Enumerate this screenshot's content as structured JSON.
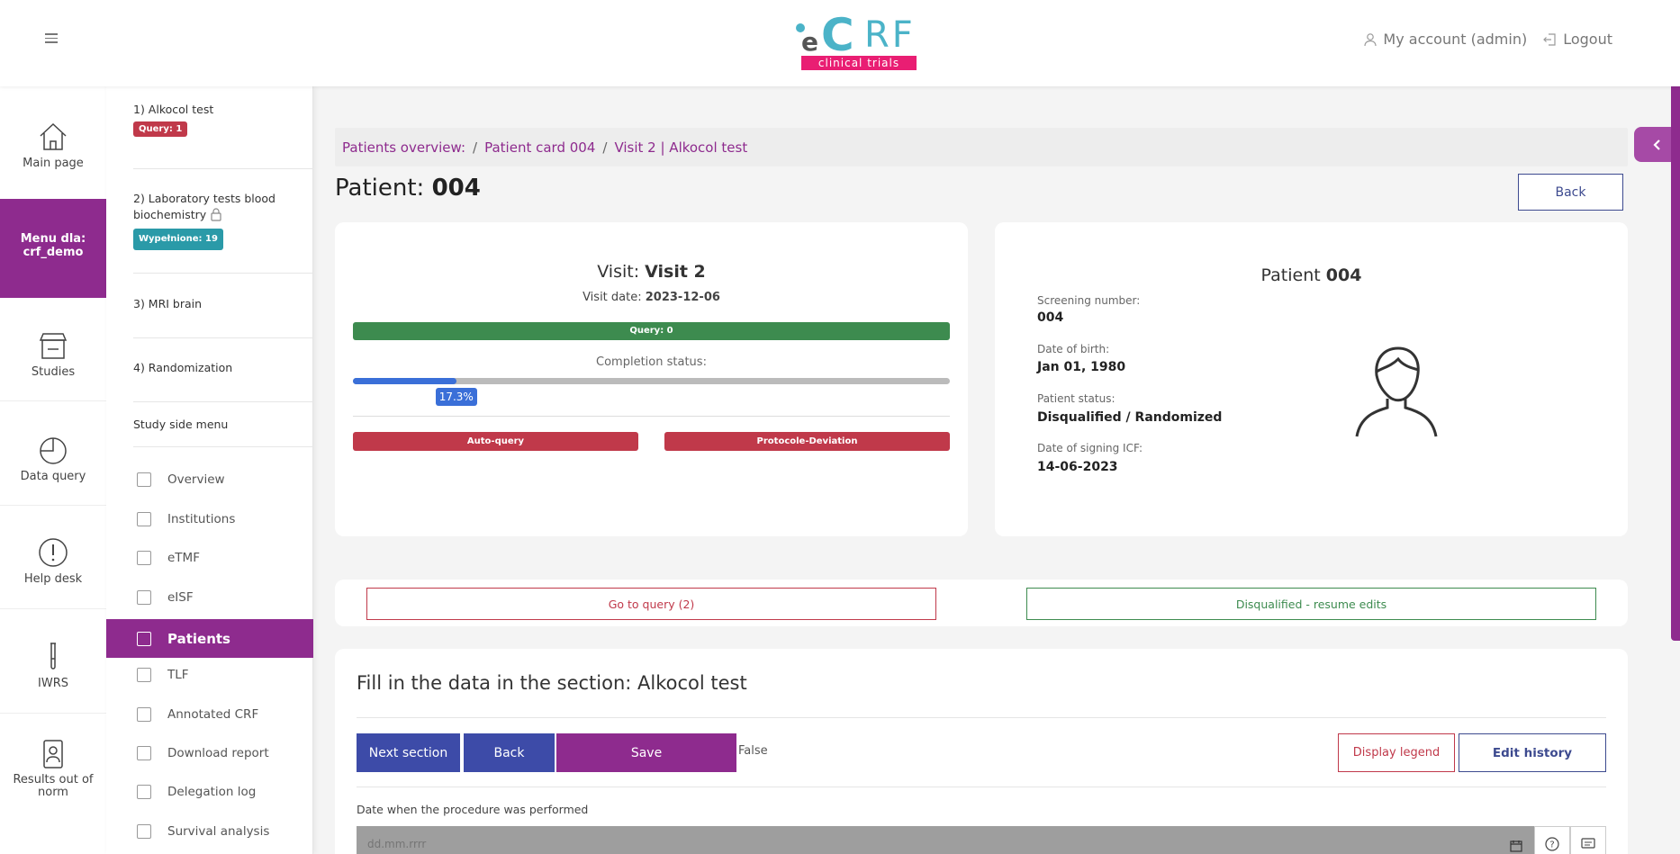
{
  "header": {
    "logo_text_e": "e",
    "logo_text_c": "C",
    "logo_text_rf": "RF",
    "logo_tagline": "clinical trials",
    "account_label": "My account (admin)",
    "logout_label": "Logout"
  },
  "leftnav": {
    "items": [
      {
        "label": "Main page",
        "icon": "home-icon"
      },
      {
        "label": "Menu dla: crf_demo",
        "icon": ""
      },
      {
        "label": "Studies",
        "icon": "studies-icon"
      },
      {
        "label": "Data query",
        "icon": "pie-chart-icon"
      },
      {
        "label": "Help desk",
        "icon": "alert-circle-icon"
      },
      {
        "label": "IWRS",
        "icon": "test-tube-icon"
      },
      {
        "label": "Results out of norm",
        "icon": "person-card-icon"
      }
    ]
  },
  "sidemenu": {
    "sections": [
      {
        "label": "1) Alkocol test",
        "badge": "Query: 1"
      },
      {
        "label": "2) Laboratory tests blood biochemistry",
        "badge": "Wypełnione: 19"
      },
      {
        "label": "3) MRI brain"
      },
      {
        "label": "4) Randomization"
      }
    ],
    "study_menu_title": "Study side menu",
    "items": [
      {
        "label": "Overview"
      },
      {
        "label": "Institutions"
      },
      {
        "label": "eTMF"
      },
      {
        "label": "eISF"
      },
      {
        "label": "Patients"
      },
      {
        "label": "TLF"
      },
      {
        "label": "Annotated CRF"
      },
      {
        "label": "Download report"
      },
      {
        "label": "Delegation log"
      },
      {
        "label": "Survival analysis"
      }
    ]
  },
  "breadcrumb": {
    "items": [
      "Patients overview:",
      "Patient card 004",
      "Visit 2 | Alkocol test"
    ],
    "separator": "/"
  },
  "page": {
    "title_prefix": "Patient:",
    "title_value": "004",
    "back_label": "Back",
    "toggle_icon": "chevron-left-icon"
  },
  "visit": {
    "title_prefix": "Visit:",
    "title_value": "Visit 2",
    "date_label": "Visit date:",
    "date_value": "2023-12-06",
    "query_label": "Query: 0",
    "completion_label": "Completion status:",
    "completion_percent": 17.3,
    "completion_text": "17.3%",
    "auto_query_label": "Auto-query",
    "protocol_label": "Protocole-Deviation"
  },
  "patient": {
    "title_prefix": "Patient",
    "title_value": "004",
    "fields": [
      {
        "label": "Screening number:",
        "value": "004"
      },
      {
        "label": "Date of birth:",
        "value": "Jan 01, 1980"
      },
      {
        "label": "Patient status:",
        "value": "Disqualified / Randomized"
      },
      {
        "label": "Date of signing ICF:",
        "value": "14-06-2023"
      }
    ]
  },
  "actions": {
    "query_label": "Go to query (2)",
    "resume_label": "Disqualified - resume edits"
  },
  "form": {
    "title": "Fill in the data in the section: Alkocol test",
    "next_label": "Next section",
    "back_label": "Back",
    "save_label": "Save",
    "false_text": "False",
    "legend_label": "Display legend",
    "history_label": "Edit history",
    "field_label": "Date when the procedure was performed",
    "field_placeholder": "dd.mm.rrrr"
  },
  "colors": {
    "primary": "#8e2b8e",
    "navy": "#3d4a8f",
    "danger": "#c0394a",
    "success": "#3d8b4f",
    "progress": "#3a6fd8"
  }
}
